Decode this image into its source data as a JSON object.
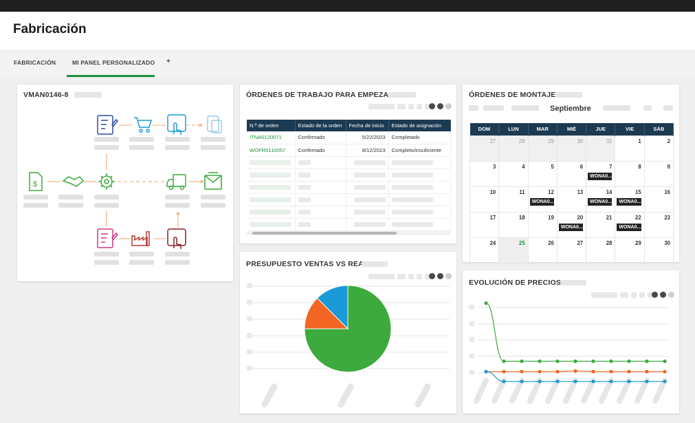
{
  "app": {
    "title": "Fabricación"
  },
  "tabs": [
    {
      "label": "FABRICACIÓN",
      "active": false
    },
    {
      "label": "MI PANEL PERSONALIZADO",
      "active": true
    },
    {
      "label": "+",
      "active": false
    }
  ],
  "process_card": {
    "title": "VMAN0146-8"
  },
  "orders_card": {
    "title": "ÓRDENES DE TRABAJO PARA EMPEZAR",
    "columns": [
      "N.º de orden",
      "Estado de la orden",
      "Fecha de inicio",
      "Estado de asignación"
    ],
    "rows": [
      [
        "ITNA0120071",
        "Confirmado",
        "5/22/2023",
        "Completado"
      ],
      [
        "WOFR0110057",
        "Confirmado",
        "8/12/2023",
        "Completo/insuficiente"
      ]
    ]
  },
  "assembly_card": {
    "title": "ÓRDENES DE MONTAJE",
    "month": "Septiembre",
    "weekdays": [
      "DOM",
      "LUN",
      "MAR",
      "MIÉ",
      "JUE",
      "VIE",
      "SÁB"
    ],
    "weeks": [
      [
        {
          "d": "27",
          "m": true
        },
        {
          "d": "28",
          "m": true
        },
        {
          "d": "29",
          "m": true
        },
        {
          "d": "30",
          "m": true
        },
        {
          "d": "31",
          "m": true
        },
        {
          "d": "1"
        },
        {
          "d": "2"
        }
      ],
      [
        {
          "d": "3"
        },
        {
          "d": "4"
        },
        {
          "d": "5"
        },
        {
          "d": "6"
        },
        {
          "d": "7",
          "e": "WONA0..."
        },
        {
          "d": "8"
        },
        {
          "d": "9"
        }
      ],
      [
        {
          "d": "10"
        },
        {
          "d": "11"
        },
        {
          "d": "12",
          "e": "WONA0..."
        },
        {
          "d": "13"
        },
        {
          "d": "14",
          "e": "WONA0..."
        },
        {
          "d": "15",
          "e": "WONA0..."
        },
        {
          "d": "16"
        }
      ],
      [
        {
          "d": "17"
        },
        {
          "d": "18"
        },
        {
          "d": "19"
        },
        {
          "d": "20",
          "e": "WONA0..."
        },
        {
          "d": "21"
        },
        {
          "d": "22",
          "e": "WONA0..."
        },
        {
          "d": "23"
        }
      ],
      [
        {
          "d": "24"
        },
        {
          "d": "25",
          "t": true
        },
        {
          "d": "26"
        },
        {
          "d": "27"
        },
        {
          "d": "28"
        },
        {
          "d": "29"
        },
        {
          "d": "30"
        }
      ]
    ]
  },
  "budget_card": {
    "title": "PRESUPUESTO VENTAS VS REAL"
  },
  "prices_card": {
    "title": "EVOLUCIÓN DE PRECIOS"
  },
  "chart_data": [
    {
      "type": "pie",
      "title": "PRESUPUESTO VENTAS VS REAL",
      "series": [
        {
          "color": "#3caa3c",
          "value": 75
        },
        {
          "color": "#f26522",
          "value": 12.5
        },
        {
          "color": "#1a9ad6",
          "value": 12.5
        }
      ]
    },
    {
      "type": "line",
      "title": "EVOLUCIÓN DE PRECIOS",
      "x": [
        1,
        2,
        3,
        4,
        5,
        6,
        7,
        8,
        9,
        10,
        11
      ],
      "series": [
        {
          "color": "#3caa3c",
          "values": [
            100,
            5,
            5,
            5,
            5,
            5,
            5,
            5,
            5,
            5,
            5
          ]
        },
        {
          "color": "#f26522",
          "values": [
            -12,
            -12,
            -12,
            -12,
            -12,
            -11,
            -12,
            -12,
            -12,
            -12,
            -12
          ]
        },
        {
          "color": "#1a9ad6",
          "values": [
            -12,
            -28,
            -28,
            -28,
            -28,
            -28,
            -28,
            -28,
            -28,
            -28,
            -28
          ]
        }
      ],
      "ylim": [
        -60,
        120
      ]
    }
  ],
  "colors": {
    "accent": "#1e8e3e",
    "table_header": "#1c3a52"
  }
}
